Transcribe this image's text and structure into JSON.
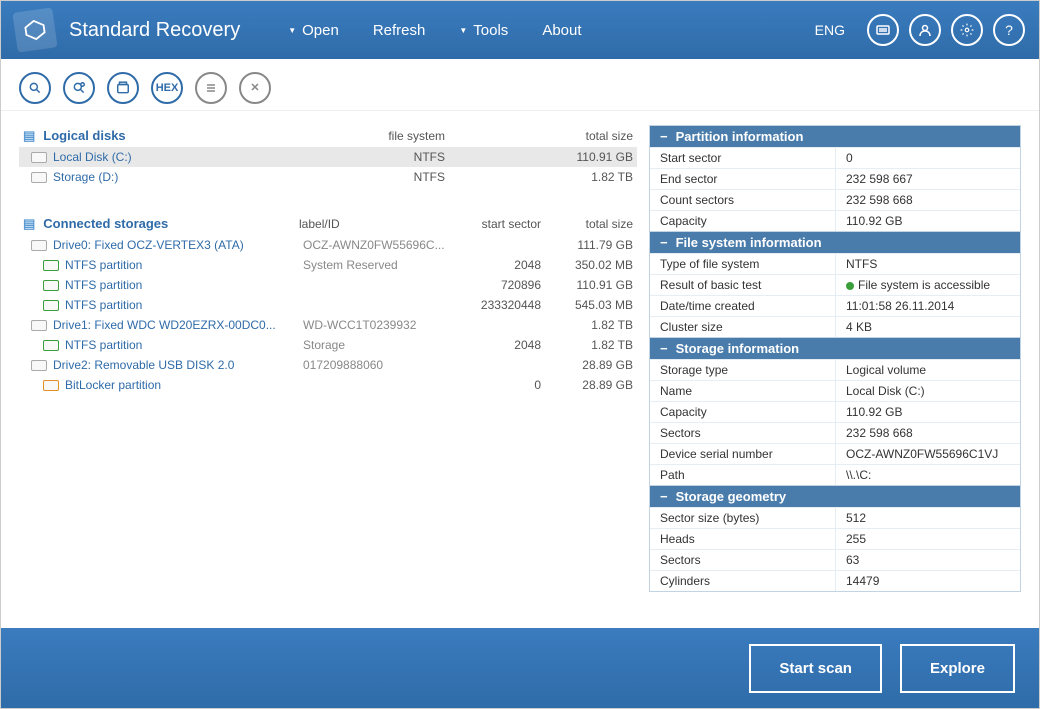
{
  "app": {
    "title": "Standard Recovery"
  },
  "menu": {
    "open": "Open",
    "refresh": "Refresh",
    "tools": "Tools",
    "about": "About"
  },
  "header": {
    "lang": "ENG"
  },
  "tree": {
    "logical_head": "Logical disks",
    "col_fs": "file system",
    "col_total": "total size",
    "connected_head": "Connected storages",
    "col_label": "label/ID",
    "col_start": "start sector",
    "logical": [
      {
        "name": "Local Disk (C:)",
        "fs": "NTFS",
        "total": "110.91 GB",
        "selected": true
      },
      {
        "name": "Storage (D:)",
        "fs": "NTFS",
        "total": "1.82 TB"
      }
    ],
    "drives": [
      {
        "name": "Drive0: Fixed OCZ-VERTEX3 (ATA)",
        "label": "OCZ-AWNZ0FW55696C...",
        "start": "",
        "total": "111.79 GB",
        "parts": [
          {
            "name": "NTFS partition",
            "label": "System Reserved",
            "start": "2048",
            "total": "350.02 MB",
            "cls": "g"
          },
          {
            "name": "NTFS partition",
            "label": "",
            "start": "720896",
            "total": "110.91 GB",
            "cls": "g"
          },
          {
            "name": "NTFS partition",
            "label": "",
            "start": "233320448",
            "total": "545.03 MB",
            "cls": "g"
          }
        ]
      },
      {
        "name": "Drive1: Fixed WDC WD20EZRX-00DC0...",
        "label": "WD-WCC1T0239932",
        "start": "",
        "total": "1.82 TB",
        "parts": [
          {
            "name": "NTFS partition",
            "label": "Storage",
            "start": "2048",
            "total": "1.82 TB",
            "cls": "g"
          }
        ]
      },
      {
        "name": "Drive2: Removable USB DISK 2.0",
        "label": "017209888060",
        "start": "",
        "total": "28.89 GB",
        "parts": [
          {
            "name": "BitLocker partition",
            "label": "",
            "start": "0",
            "total": "28.89 GB",
            "cls": "o"
          }
        ]
      }
    ]
  },
  "info": {
    "partition": {
      "title": "Partition information",
      "rows": [
        {
          "k": "Start sector",
          "v": "0"
        },
        {
          "k": "End sector",
          "v": "232 598 667"
        },
        {
          "k": "Count sectors",
          "v": "232 598 668"
        },
        {
          "k": "Capacity",
          "v": "110.92 GB"
        }
      ]
    },
    "fs": {
      "title": "File system information",
      "rows": [
        {
          "k": "Type of file system",
          "v": "NTFS"
        },
        {
          "k": "Result of basic test",
          "v": "File system is accessible",
          "dot": true
        },
        {
          "k": "Date/time created",
          "v": "11:01:58 26.11.2014"
        },
        {
          "k": "Cluster size",
          "v": "4 KB"
        }
      ]
    },
    "storage": {
      "title": "Storage information",
      "rows": [
        {
          "k": "Storage type",
          "v": "Logical volume"
        },
        {
          "k": "Name",
          "v": "Local Disk (C:)"
        },
        {
          "k": "Capacity",
          "v": "110.92 GB"
        },
        {
          "k": "Sectors",
          "v": "232 598 668"
        },
        {
          "k": "Device serial number",
          "v": "OCZ-AWNZ0FW55696C1VJ"
        },
        {
          "k": "Path",
          "v": "\\\\.\\C:"
        }
      ]
    },
    "geom": {
      "title": "Storage geometry",
      "rows": [
        {
          "k": "Sector size (bytes)",
          "v": "512"
        },
        {
          "k": "Heads",
          "v": "255"
        },
        {
          "k": "Sectors",
          "v": "63"
        },
        {
          "k": "Cylinders",
          "v": "14479"
        }
      ]
    }
  },
  "footer": {
    "scan": "Start scan",
    "explore": "Explore"
  }
}
